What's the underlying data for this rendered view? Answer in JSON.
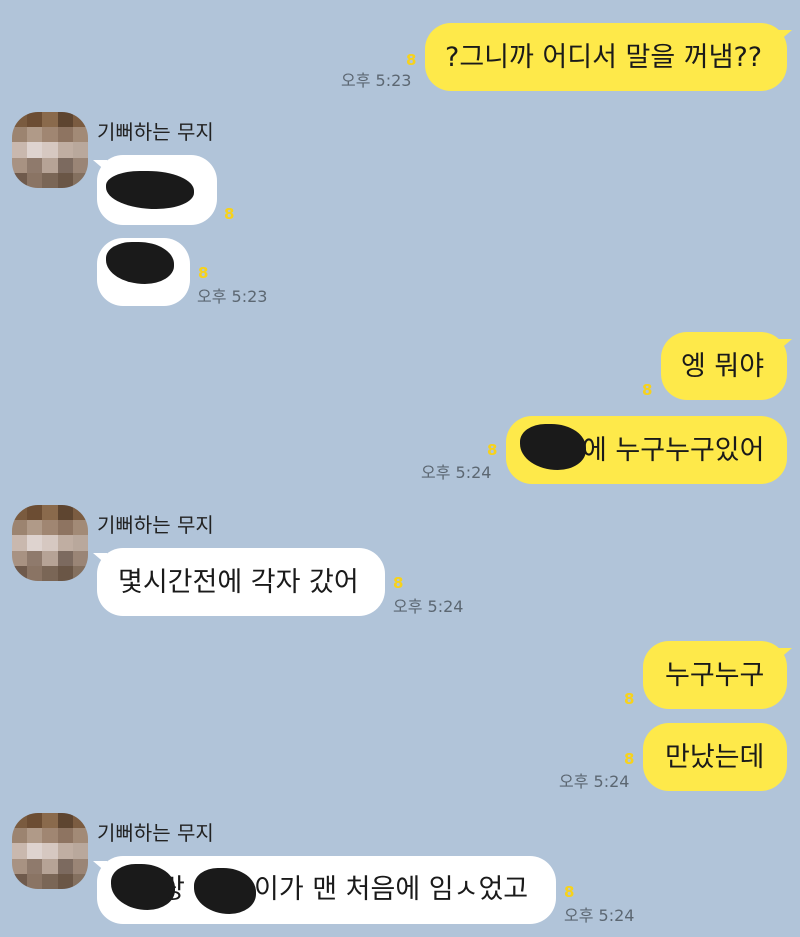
{
  "contact": {
    "name": "기뻐하는 무지"
  },
  "messages": {
    "m1": {
      "text": "?그니까 어디서 말을 꺼냄??",
      "unread": "8",
      "time": "오후 5:23"
    },
    "m2": {
      "unread": "8"
    },
    "m3": {
      "unread": "8",
      "time": "오후 5:23"
    },
    "m4": {
      "text": "엥 뭐야",
      "unread": "8"
    },
    "m5": {
      "text": "에 누구누구있어",
      "unread": "8",
      "time": "오후 5:24"
    },
    "m6": {
      "text": "몇시간전에 각자 갔어",
      "unread": "8",
      "time": "오후 5:24"
    },
    "m7": {
      "text": "누구누구",
      "unread": "8"
    },
    "m8": {
      "text": "만났는데",
      "unread": "8",
      "time": "오후 5:24"
    },
    "m9": {
      "text_a": "랑",
      "text_b": "이가 맨 처음에 임ㅅ었고",
      "unread": "8",
      "time": "오후 5:24"
    }
  },
  "colors": {
    "background": "#b1c4d9",
    "my_bubble": "#fee94a",
    "their_bubble": "#ffffff",
    "unread": "#f7d21b"
  }
}
